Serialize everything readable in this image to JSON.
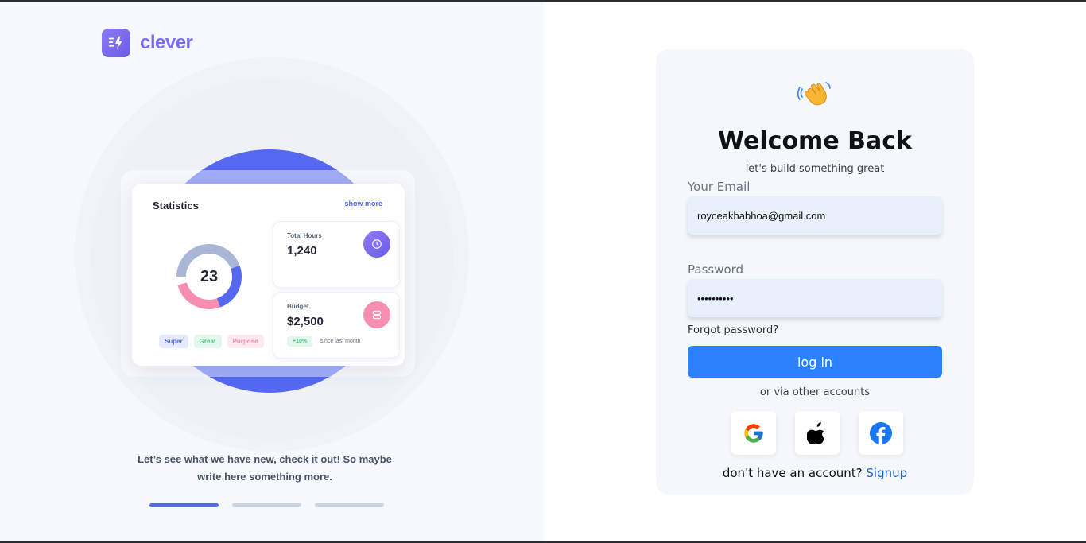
{
  "brand": {
    "name": "clever",
    "logo_icon": "bolt-icon"
  },
  "illustration": {
    "stats": {
      "title": "Statistics",
      "show_more": "show more",
      "donut_value": "23",
      "tags": [
        "Super",
        "Great",
        "Purpose"
      ],
      "total_hours": {
        "label": "Total Hours",
        "value": "1,240",
        "icon": "clock-icon"
      },
      "budget": {
        "label": "Budget",
        "value": "$2,500",
        "badge": "+10%",
        "since": "since last month",
        "icon": "toggle-icon"
      }
    },
    "caption": "Let’s see what we have new, check it out! So maybe write here something more.",
    "carousel": {
      "count": 3,
      "active": 0
    }
  },
  "login": {
    "wave_icon": "waving-hand-icon",
    "title": "Welcome Back",
    "subtitle": "let's build something great",
    "email_label": "Your Email",
    "email_value": "royceakhabhoa@gmail.com",
    "password_label": "Password",
    "password_value": "••••••••••",
    "forgot": "Forgot password?",
    "login_button": "log in",
    "via": "or via other accounts",
    "social": [
      "google-icon",
      "apple-icon",
      "facebook-icon"
    ],
    "no_account": "don't have an account?",
    "signup": "Signup"
  },
  "colors": {
    "brand": "#7b6cf0",
    "primary_button": "#2d81ff",
    "accent_blue": "#5468f2",
    "link": "#1e63c9"
  }
}
